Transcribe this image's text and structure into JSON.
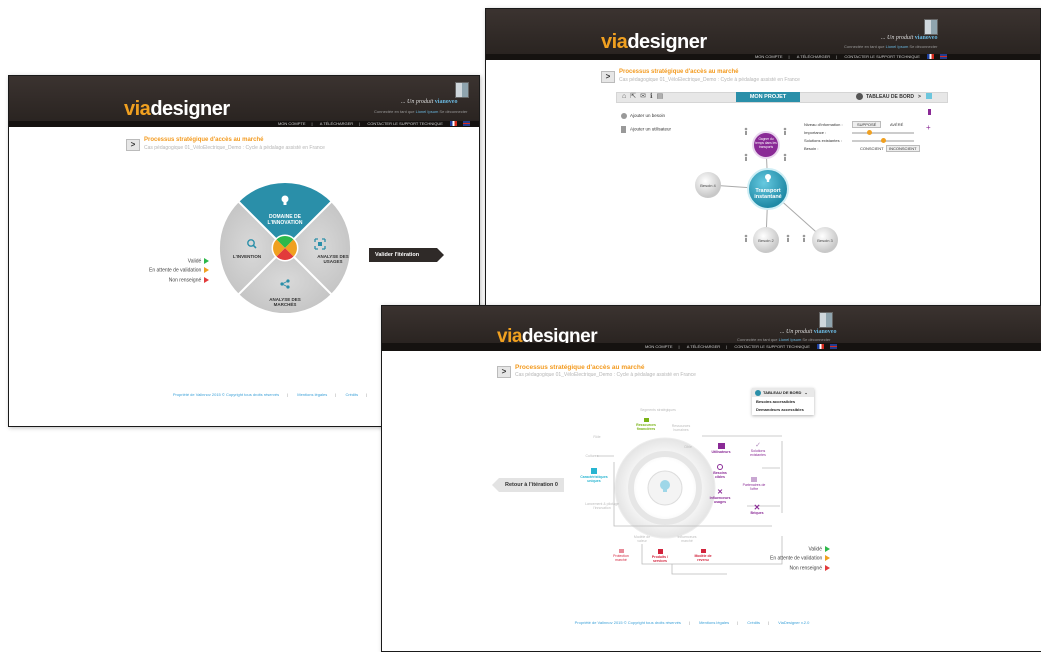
{
  "brand": {
    "via": "via",
    "designer": "designer",
    "tagline_prefix": "... Un produit ",
    "tagline_brand": "via",
    "tagline_suffix": "noveo",
    "connection_prefix": "Connectée en tant que ",
    "connection_user": "Lionel Ipsum",
    "connection_logout": "Se déconnecter"
  },
  "nav": {
    "account": "MON COMPTE",
    "download": "A TÉLÉCHARGER",
    "support": "CONTACTER LE SUPPORT TECHNIQUE",
    "sep": "|"
  },
  "process": {
    "title": "Processus stratégique d'accès au marché",
    "subtitle": "Cas pédagogique 01_VéloElectrique_Demo : Cycle à pédalage assisté en France"
  },
  "footer": {
    "copyright": "Propriété de Valinnov 2015 © Copyright tous droits réservés",
    "legal": "Mentions légales",
    "credits": "Crédits",
    "version": "ViaDesigner v.2.0"
  },
  "legend": {
    "valid": "Validé",
    "pending": "En attente de validation",
    "empty": "Non renseigné"
  },
  "colors": {
    "header": "#2f2825",
    "accent": "#f0a020",
    "teal": "#2a9fbd",
    "purple": "#8a2a96",
    "red": "#d2233c"
  },
  "screen1": {
    "domain_label": "DOMAINE DE L'INNOVATION",
    "invention_label": "L'INVENTION",
    "usages_label": "ANALYSE DES USAGES",
    "markets_label": "ANALYSE DES MARCHÉS",
    "validate_button": "Valider l'itération",
    "icons": {
      "domain": "lightbulb-icon",
      "invention": "magnifier-icon",
      "usages": "focus-icon",
      "markets": "share-icon"
    }
  },
  "screen2": {
    "project_button": "MON PROJET",
    "dashboard_button": "TABLEAU DE BORD",
    "add_need": "Ajouter un besoin",
    "add_user": "Ajouter un utilisateur",
    "center_label": "Transport instantané",
    "purple_label": "Gagner du temps dans les transports",
    "needs": [
      "Besoin 4",
      "Besoin 2",
      "Besoin 3"
    ],
    "info_level_label": "Niveau d'information :",
    "importance_label": "Importance :",
    "existing_label": "Solutions existantes :",
    "need_label": "Besoin :",
    "info_low": "SUPPOSÉ",
    "info_high": "AVÉRÉ",
    "need_conscious": "CONSCIENT",
    "need_unconscious": "INCONSCIENT",
    "importance_value": 0.25,
    "existing_value": 0.5
  },
  "screen3": {
    "back_button": "Retour à l'itération 0",
    "dashboard_title": "TABLEAU DE BORD",
    "dashboard_items": [
      "Besoins accessibles",
      "Demandeurs accessibles"
    ],
    "nodes": {
      "segments_strategiques": "Segments stratégiques",
      "ressources_financieres": "Ressources financières",
      "ressources_humaines": "Ressources humaines",
      "role": "Rôle",
      "cible": "Cible",
      "cultures": "Cultures",
      "caracteristiques_uniques": "Caractéristiques uniques",
      "utilisateurs": "Utilisateurs",
      "solutions_existantes": "Solutions existantes",
      "besoins_cibles": "Besoins cibles",
      "partenaires_offre": "Partenaires de l'offre",
      "influenceurs_usages": "Influenceurs usages",
      "briques": "Briques",
      "lancement": "Lancement & pilotage l'innovation",
      "modele_valeur": "Modèle de valeur",
      "influenceurs_marche": "Influenceurs marché",
      "protection_marche": "Protection marché",
      "produits_services": "Produits / services",
      "modele_revenu": "Modèle de revenu"
    }
  }
}
